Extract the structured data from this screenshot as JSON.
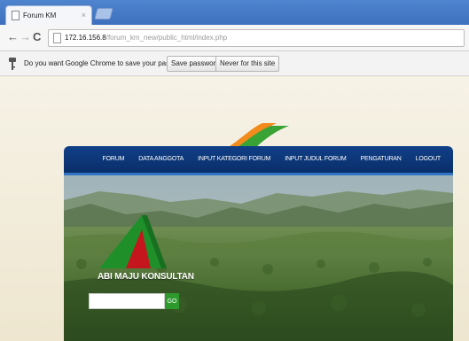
{
  "browser": {
    "tab_title": "Forum KM",
    "tab_close": "×",
    "url_host": "172.16.156.8",
    "url_path": "/forum_km_new/public_html/index.php"
  },
  "infobar": {
    "message": "Do you want Google Chrome to save your password?",
    "save_label": "Save password",
    "never_label": "Never for this site"
  },
  "site": {
    "nav": [
      {
        "label": "FORUM"
      },
      {
        "label": "DATA ANGGOTA"
      },
      {
        "label": "INPUT KATEGORI FORUM"
      },
      {
        "label": "INPUT JUDUL FORUM"
      },
      {
        "label": "PENGATURAN"
      },
      {
        "label": "LOGOUT"
      }
    ],
    "brand": "ABI MAJU KONSULTAN",
    "search": {
      "value": "",
      "go_label": "GO"
    }
  },
  "colors": {
    "navbar": "#0a2f6a",
    "logo_green": "#1f8f2a",
    "logo_red": "#c4161c",
    "go_button": "#2e9a2e"
  },
  "icons": {
    "back": "back-arrow-icon",
    "forward": "forward-arrow-icon",
    "reload": "reload-icon",
    "key": "key-icon"
  }
}
